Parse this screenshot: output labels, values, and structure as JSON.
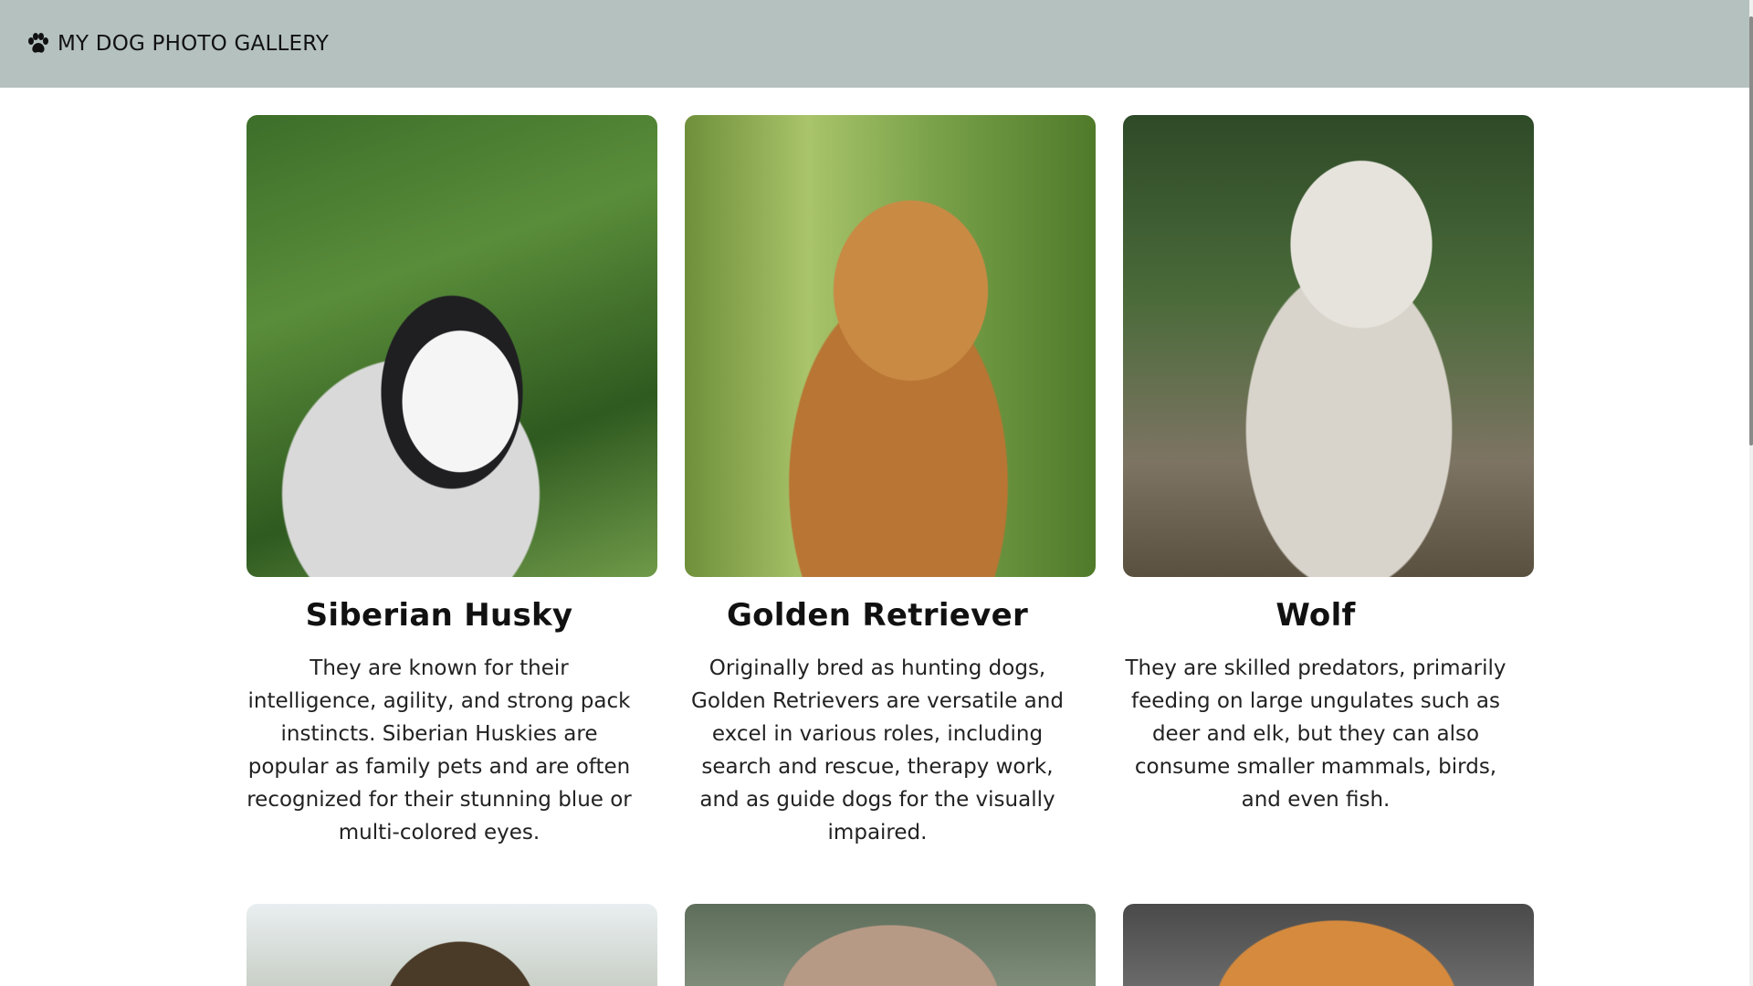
{
  "header": {
    "title": "MY DOG PHOTO GALLERY",
    "icon": "paw-icon",
    "background_color": "#b4c1bf"
  },
  "cards": [
    {
      "name": "Siberian Husky",
      "description": "They are known for their intelligence, agility, and strong pack instincts. Siberian Huskies are popular as family pets and are often recognized for their stunning blue or multi-colored eyes."
    },
    {
      "name": "Golden Retriever",
      "description": "Originally bred as hunting dogs, Golden Retrievers are versatile and excel in various roles, including search and rescue, therapy work, and as guide dogs for the visually impaired."
    },
    {
      "name": "Wolf",
      "description": "They are skilled predators, primarily feeding on large ungulates such as deer and elk, but they can also consume smaller mammals, birds, and even fish."
    }
  ]
}
